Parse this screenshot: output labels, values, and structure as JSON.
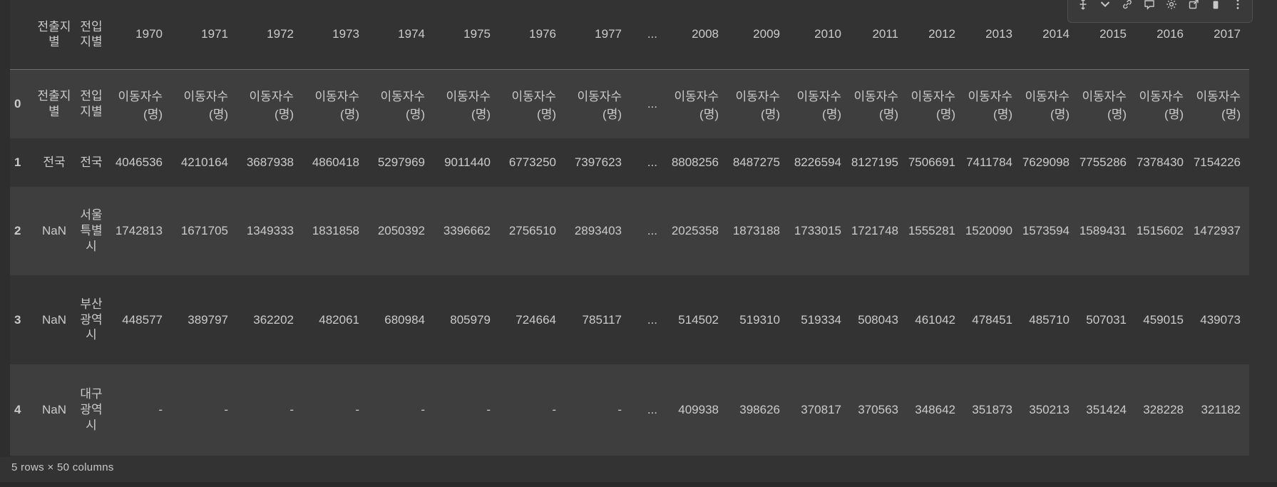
{
  "toolbar": {
    "icons": [
      "split-cell-icon",
      "collapse-output-icon",
      "link-icon",
      "comment-icon",
      "gear-icon",
      "open-in-editor-icon",
      "trash-icon",
      "more-actions-icon"
    ]
  },
  "table": {
    "header": {
      "index_label": "",
      "from_label": "전출지별",
      "to_label": "전입지별",
      "years": [
        "1970",
        "1971",
        "1972",
        "1973",
        "1974",
        "1975",
        "1976",
        "1977",
        "...",
        "2008",
        "2009",
        "2010",
        "2011",
        "2012",
        "2013",
        "2014",
        "2015",
        "2016",
        "2017"
      ]
    },
    "rows": [
      {
        "index": "0",
        "from": "전출지별",
        "to": "전입지별",
        "values": [
          "이동자수 (명)",
          "이동자수 (명)",
          "이동자수 (명)",
          "이동자수 (명)",
          "이동자수 (명)",
          "이동자수 (명)",
          "이동자수 (명)",
          "이동자수 (명)",
          "...",
          "이동자수 (명)",
          "이동자수 (명)",
          "이동자수 (명)",
          "이동자수 (명)",
          "이동자수 (명)",
          "이동자수 (명)",
          "이동자수 (명)",
          "이동자수 (명)",
          "이동자수 (명)",
          "이동자수 (명)"
        ]
      },
      {
        "index": "1",
        "from": "전국",
        "to": "전국",
        "values": [
          "4046536",
          "4210164",
          "3687938",
          "4860418",
          "5297969",
          "9011440",
          "6773250",
          "7397623",
          "...",
          "8808256",
          "8487275",
          "8226594",
          "8127195",
          "7506691",
          "7411784",
          "7629098",
          "7755286",
          "7378430",
          "7154226"
        ]
      },
      {
        "index": "2",
        "from": "NaN",
        "to": "서울특별시",
        "values": [
          "1742813",
          "1671705",
          "1349333",
          "1831858",
          "2050392",
          "3396662",
          "2756510",
          "2893403",
          "...",
          "2025358",
          "1873188",
          "1733015",
          "1721748",
          "1555281",
          "1520090",
          "1573594",
          "1589431",
          "1515602",
          "1472937"
        ]
      },
      {
        "index": "3",
        "from": "NaN",
        "to": "부산광역시",
        "values": [
          "448577",
          "389797",
          "362202",
          "482061",
          "680984",
          "805979",
          "724664",
          "785117",
          "...",
          "514502",
          "519310",
          "519334",
          "508043",
          "461042",
          "478451",
          "485710",
          "507031",
          "459015",
          "439073"
        ]
      },
      {
        "index": "4",
        "from": "NaN",
        "to": "대구광역시",
        "values": [
          "-",
          "-",
          "-",
          "-",
          "-",
          "-",
          "-",
          "-",
          "...",
          "409938",
          "398626",
          "370817",
          "370563",
          "348642",
          "351873",
          "350213",
          "351424",
          "328228",
          "321182"
        ]
      }
    ],
    "footer": "5 rows × 50 columns"
  },
  "colors": {
    "background": "#333333",
    "row_stripe": "#3e3e3e",
    "text": "#cbcbcb",
    "header_border": "#6f6f6f"
  }
}
